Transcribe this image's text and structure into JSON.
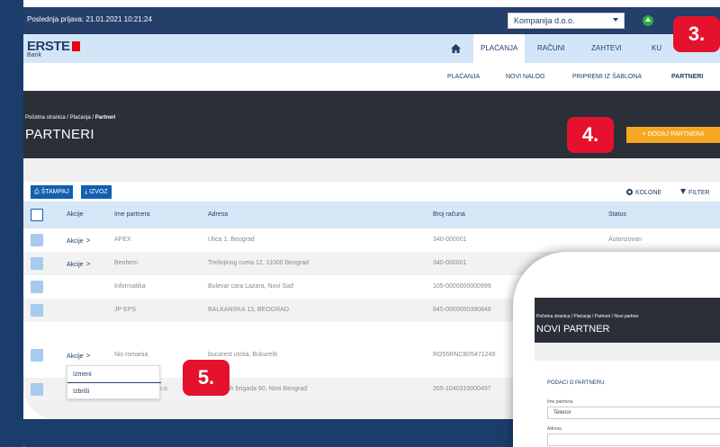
{
  "topbar": {
    "last_login": "Poslednja prijava: 21.01.2021 10:21:24",
    "company": "Kompanija d.o.o."
  },
  "logo": {
    "brand": "ERSTE",
    "bank": "Bank"
  },
  "mainnav": {
    "items": [
      {
        "label": "PLAĆANJA",
        "active": true
      },
      {
        "label": "RAČUNI",
        "active": false
      },
      {
        "label": "ZAHTEVI",
        "active": false
      },
      {
        "label": "KU",
        "active": false
      }
    ]
  },
  "subnav": {
    "items": [
      {
        "label": "PLAĆANJA"
      },
      {
        "label": "NOVI NALOG"
      },
      {
        "label": "PRIPREMI IZ ŠABLONA"
      },
      {
        "label": "PARTNERI"
      }
    ]
  },
  "breadcrumb": {
    "home": "Početna stranica",
    "sep": "/",
    "payments": "Plaćanja",
    "current": "Partneri"
  },
  "page_title": "PARTNERI",
  "add_partner": "+ DODAJ PARTNERA",
  "toolbar": {
    "print": "ŠTAMPAJ",
    "export": "IZVOZ",
    "columns": "KOLONE",
    "filter": "FILTER"
  },
  "table": {
    "headers": {
      "actions": "Akcije",
      "name": "Ime partnera",
      "address": "Adresa",
      "account": "Broj računa",
      "status": "Status"
    },
    "rows": [
      {
        "actions": "Akcije",
        "name": "APEX",
        "address": "Ulica 1, Beograd",
        "account": "340-000001",
        "status": "Autorizovan"
      },
      {
        "actions": "Akcije",
        "name": "Beohem",
        "address": "Trešnjinog cveta 12, 11000 Beograd",
        "account": "340-000001",
        "status": ""
      },
      {
        "actions": "",
        "name": "Informatika",
        "address": "Bulevar cara Lazara, Novi Sad",
        "account": "105-0000000000999",
        "status": ""
      },
      {
        "actions": "",
        "name": "JP EPS",
        "address": "BALKANSKA 13, BEOGRAD",
        "account": "845-0000000390849",
        "status": ""
      },
      {
        "actions": "Akcije",
        "name": "Nis romania",
        "address": "bucarest utcka, Bukurešt",
        "account": "RO55RNCB05471249",
        "status": ""
      },
      {
        "actions": "",
        "name": "o.o.",
        "address": "adinskih brigada 90, Novi Beograd",
        "account": "265-1040310000497",
        "status": ""
      }
    ]
  },
  "row_menu": {
    "edit": "Izmeni",
    "delete": "Izbriši"
  },
  "callouts": {
    "three": "3.",
    "four": "4.",
    "five": "5."
  },
  "new_partner": {
    "breadcrumb": "Početna stranica / Plaćanja / Partneri / Novi partner",
    "title": "NOVI PARTNER",
    "section": "PODACI O PARTNERU",
    "name_label": "Ime partnera",
    "name_value": "Telenor",
    "address_label": "Adresa"
  },
  "colors": {
    "navy": "#233f6a",
    "orange": "#f7a823",
    "red": "#e4122c",
    "light_blue": "#d3e6f8"
  }
}
